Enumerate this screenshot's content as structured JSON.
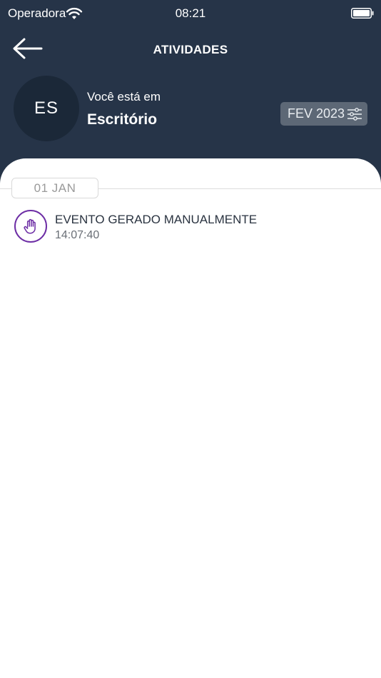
{
  "status_bar": {
    "carrier": "Operadora",
    "time": "08:21"
  },
  "header": {
    "title": "ATIVIDADES"
  },
  "location": {
    "initials": "ES",
    "label": "Você está em",
    "name": "Escritório"
  },
  "filter": {
    "period": "FEV 2023"
  },
  "activities": {
    "date": "01 JAN",
    "items": [
      {
        "title": "EVENTO GERADO MANUALMENTE",
        "time": "14:07:40",
        "icon": "hand-icon"
      }
    ]
  },
  "colors": {
    "header_bg": "#263448",
    "avatar_bg": "#1b2838",
    "filter_bg": "#5d6876",
    "event_accent": "#6d2ea5"
  }
}
